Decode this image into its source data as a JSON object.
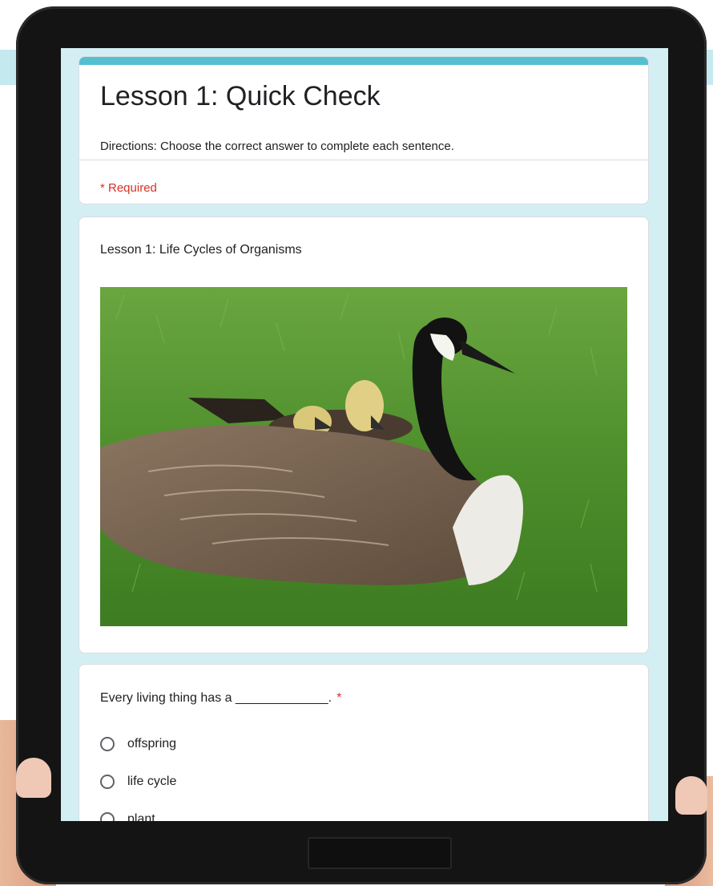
{
  "form": {
    "title": "Lesson 1: Quick Check",
    "description": "Directions: Choose the correct answer to complete each sentence.",
    "required_note": "* Required",
    "accent_color": "#55bfd2",
    "background_color": "#d4eff4"
  },
  "section": {
    "title": "Lesson 1: Life Cycles of Organisms",
    "image_subject": "Canada goose with two goslings on grass"
  },
  "question": {
    "text": "Every living thing has a _____________.",
    "required_mark": "*",
    "options": [
      {
        "label": "offspring"
      },
      {
        "label": "life cycle"
      },
      {
        "label": "plant"
      }
    ]
  }
}
